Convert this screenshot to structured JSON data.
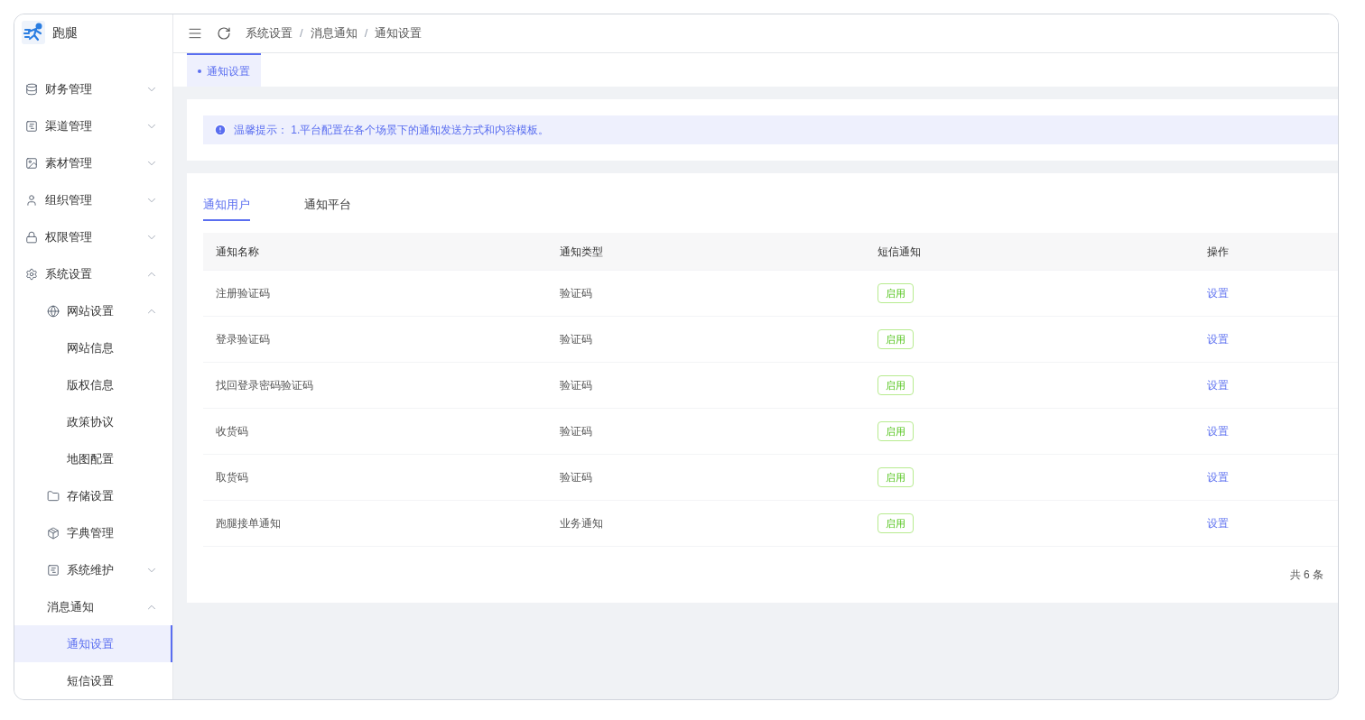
{
  "app": {
    "name": "跑腿"
  },
  "sidebar": {
    "items": [
      {
        "label": "财务管理",
        "expanded": false
      },
      {
        "label": "渠道管理",
        "expanded": false
      },
      {
        "label": "素材管理",
        "expanded": false
      },
      {
        "label": "组织管理",
        "expanded": false
      },
      {
        "label": "权限管理",
        "expanded": false
      },
      {
        "label": "系统设置",
        "expanded": true,
        "children": [
          {
            "label": "网站设置",
            "expanded": true,
            "children": [
              {
                "label": "网站信息",
                "selected": false
              },
              {
                "label": "版权信息",
                "selected": false
              },
              {
                "label": "政策协议",
                "selected": false
              },
              {
                "label": "地图配置",
                "selected": false
              }
            ]
          },
          {
            "label": "存储设置",
            "selected": false
          },
          {
            "label": "字典管理",
            "selected": false
          },
          {
            "label": "系统维护",
            "expanded": false
          },
          {
            "label": "消息通知",
            "expanded": true,
            "children": [
              {
                "label": "通知设置",
                "selected": true
              },
              {
                "label": "短信设置",
                "selected": false
              }
            ]
          }
        ]
      }
    ]
  },
  "breadcrumb": {
    "separator": "/",
    "items": [
      "系统设置",
      "消息通知",
      "通知设置"
    ]
  },
  "page_tabs": [
    {
      "label": "通知设置",
      "selected": true
    }
  ],
  "notice": {
    "text": "温馨提示： 1.平台配置在各个场景下的通知发送方式和内容模板。"
  },
  "tabs": [
    {
      "label": "通知用户",
      "selected": true
    },
    {
      "label": "通知平台",
      "selected": false
    }
  ],
  "table": {
    "columns": [
      "通知名称",
      "通知类型",
      "短信通知",
      "操作"
    ],
    "rows": [
      {
        "name": "注册验证码",
        "type": "验证码",
        "sms": "启用",
        "action": "设置"
      },
      {
        "name": "登录验证码",
        "type": "验证码",
        "sms": "启用",
        "action": "设置"
      },
      {
        "name": "找回登录密码验证码",
        "type": "验证码",
        "sms": "启用",
        "action": "设置"
      },
      {
        "name": "收货码",
        "type": "验证码",
        "sms": "启用",
        "action": "设置"
      },
      {
        "name": "取货码",
        "type": "验证码",
        "sms": "启用",
        "action": "设置"
      },
      {
        "name": "跑腿接单通知",
        "type": "业务通知",
        "sms": "启用",
        "action": "设置"
      }
    ]
  },
  "pagination": {
    "total": "共 6 条"
  }
}
